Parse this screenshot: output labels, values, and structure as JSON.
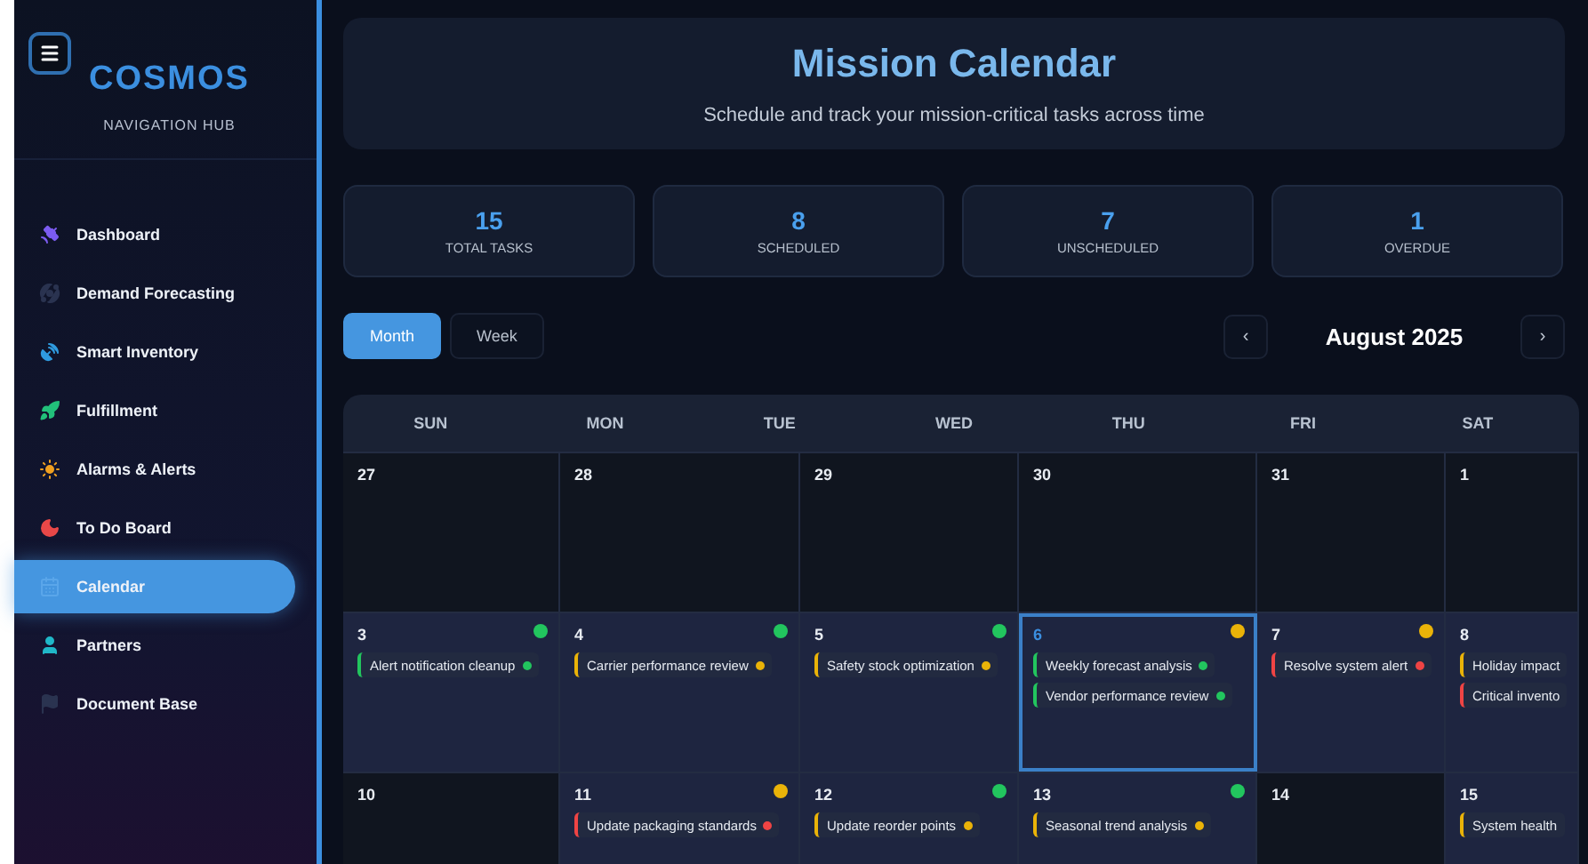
{
  "sidebar": {
    "brand": "COSMOS",
    "subtitle": "NAVIGATION HUB",
    "items": [
      {
        "label": "Dashboard",
        "color": "#7c5cf0",
        "selected": false
      },
      {
        "label": "Demand Forecasting",
        "color": "#2a3350",
        "selected": false
      },
      {
        "label": "Smart Inventory",
        "color": "#2f9be0",
        "selected": false
      },
      {
        "label": "Fulfillment",
        "color": "#22c07a",
        "selected": false
      },
      {
        "label": "Alarms & Alerts",
        "color": "#f0a020",
        "selected": false
      },
      {
        "label": "To Do Board",
        "color": "#e84848",
        "selected": false
      },
      {
        "label": "Calendar",
        "color": "#5aa6ea",
        "selected": true
      },
      {
        "label": "Partners",
        "color": "#20b8c8",
        "selected": false
      },
      {
        "label": "Document Base",
        "color": "#2a3350",
        "selected": false
      }
    ]
  },
  "header": {
    "title": "Mission Calendar",
    "subtitle": "Schedule and track your mission-critical tasks across time"
  },
  "stats": [
    {
      "value": "15",
      "label": "TOTAL TASKS"
    },
    {
      "value": "8",
      "label": "SCHEDULED"
    },
    {
      "value": "7",
      "label": "UNSCHEDULED"
    },
    {
      "value": "1",
      "label": "OVERDUE"
    }
  ],
  "views": [
    {
      "label": "Month",
      "selected": true
    },
    {
      "label": "Week",
      "selected": false
    }
  ],
  "nav": {
    "prev": "‹",
    "month": "August 2025",
    "next": "›"
  },
  "weekdays": [
    "SUN",
    "MON",
    "TUE",
    "WED",
    "THU",
    "FRI",
    "SAT"
  ],
  "weeks": [
    [
      {
        "day": "27",
        "shaded": true,
        "today": false
      },
      {
        "day": "28",
        "shaded": true,
        "today": false
      },
      {
        "day": "29",
        "shaded": true,
        "today": false
      },
      {
        "day": "30",
        "shaded": true,
        "today": false
      },
      {
        "day": "31",
        "shaded": true,
        "today": false
      },
      {
        "day": "1",
        "shaded": true,
        "today": false
      }
    ],
    [
      {
        "day": "3",
        "shaded": false,
        "today": false,
        "color": "#22c55e",
        "tasks": [
          {
            "title": "Alert notification cleanup",
            "color": "#22c55e",
            "dot": true
          }
        ]
      },
      {
        "day": "4",
        "shaded": false,
        "today": false,
        "color": "#22c55e",
        "tasks": [
          {
            "title": "Carrier performance review",
            "color": "#eab308",
            "dot": true
          }
        ]
      },
      {
        "day": "5",
        "shaded": false,
        "today": false,
        "color": "#22c55e",
        "tasks": [
          {
            "title": "Safety stock optimization",
            "color": "#eab308",
            "dot": true
          }
        ]
      },
      {
        "day": "6",
        "shaded": false,
        "today": true,
        "color": "#eab308",
        "tasks": [
          {
            "title": "Weekly forecast analysis",
            "color": "#22c55e",
            "dot": true
          },
          {
            "title": "Vendor performance review",
            "color": "#22c55e",
            "dot": true
          }
        ]
      },
      {
        "day": "7",
        "shaded": false,
        "today": false,
        "color": "#eab308",
        "tasks": [
          {
            "title": "Resolve system alert",
            "color": "#ef4444",
            "dot": true
          }
        ]
      },
      {
        "day": "8",
        "shaded": false,
        "today": false,
        "tasks": [
          {
            "title": "Holiday impact",
            "color": "#eab308",
            "dot": false
          },
          {
            "title": "Critical invento",
            "color": "#ef4444",
            "dot": false
          }
        ]
      }
    ],
    [
      {
        "day": "10",
        "shaded": true,
        "today": false
      },
      {
        "day": "11",
        "shaded": false,
        "today": false,
        "color": "#eab308",
        "tasks": [
          {
            "title": "Update packaging standards",
            "color": "#ef4444",
            "dot": true
          }
        ]
      },
      {
        "day": "12",
        "shaded": false,
        "today": false,
        "color": "#22c55e",
        "tasks": [
          {
            "title": "Update reorder points",
            "color": "#eab308",
            "dot": true
          }
        ]
      },
      {
        "day": "13",
        "shaded": false,
        "today": false,
        "color": "#22c55e",
        "tasks": [
          {
            "title": "Seasonal trend analysis",
            "color": "#eab308",
            "dot": true
          }
        ]
      },
      {
        "day": "14",
        "shaded": true,
        "today": false
      },
      {
        "day": "15",
        "shaded": false,
        "today": false,
        "tasks": [
          {
            "title": "System health",
            "color": "#eab308",
            "dot": false
          }
        ]
      }
    ]
  ]
}
